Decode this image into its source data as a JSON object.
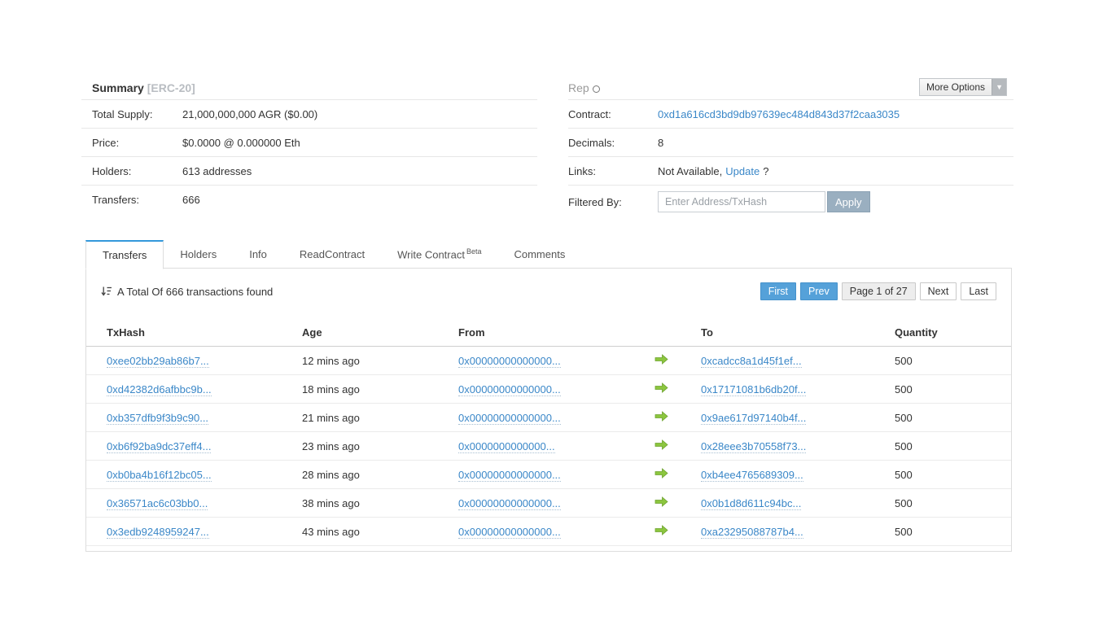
{
  "summary": {
    "title": "Summary",
    "title_tag": "[ERC-20]",
    "rows": [
      {
        "label": "Total Supply:",
        "value": "21,000,000,000 AGR ($0.00)"
      },
      {
        "label": "Price:",
        "value": "$0.0000 @ 0.000000 Eth"
      },
      {
        "label": "Holders:",
        "value": "613 addresses"
      },
      {
        "label": "Transfers:",
        "value": "666"
      }
    ]
  },
  "profile": {
    "title": "Rep",
    "more_options_label": "More Options",
    "rows": {
      "contract_label": "Contract:",
      "contract_value": "0xd1a616cd3bd9db97639ec484d843d37f2caa3035",
      "decimals_label": "Decimals:",
      "decimals_value": "8",
      "links_label": "Links:",
      "links_value": "Not Available,",
      "links_update": "Update",
      "links_question": "?",
      "filtered_label": "Filtered By:"
    },
    "filter": {
      "placeholder": "Enter Address/TxHash",
      "apply_label": "Apply"
    }
  },
  "tabs": [
    {
      "label": "Transfers"
    },
    {
      "label": "Holders"
    },
    {
      "label": "Info"
    },
    {
      "label": "ReadContract"
    },
    {
      "label": "Write Contract",
      "badge": "Beta"
    },
    {
      "label": "Comments"
    }
  ],
  "transfers": {
    "total_text": "A Total Of 666 transactions found",
    "pagination": {
      "first": "First",
      "prev": "Prev",
      "page": "Page 1 of 27",
      "next": "Next",
      "last": "Last"
    },
    "table": {
      "headers": [
        "TxHash",
        "Age",
        "From",
        "To",
        "Quantity"
      ],
      "rows": [
        {
          "txhash": "0xee02bb29ab86b7...",
          "age": "12 mins ago",
          "from": "0x00000000000000...",
          "to": "0xcadcc8a1d45f1ef...",
          "quantity": "500"
        },
        {
          "txhash": "0xd42382d6afbbc9b...",
          "age": "18 mins ago",
          "from": "0x00000000000000...",
          "to": "0x17171081b6db20f...",
          "quantity": "500"
        },
        {
          "txhash": "0xb357dfb9f3b9c90...",
          "age": "21 mins ago",
          "from": "0x00000000000000...",
          "to": "0x9ae617d97140b4f...",
          "quantity": "500"
        },
        {
          "txhash": "0xb6f92ba9dc37eff4...",
          "age": "23 mins ago",
          "from": "0x0000000000000...",
          "to": "0x28eee3b70558f73...",
          "quantity": "500"
        },
        {
          "txhash": "0xb0ba4b16f12bc05...",
          "age": "28 mins ago",
          "from": "0x00000000000000...",
          "to": "0xb4ee4765689309...",
          "quantity": "500"
        },
        {
          "txhash": "0x36571ac6c03bb0...",
          "age": "38 mins ago",
          "from": "0x00000000000000...",
          "to": "0x0b1d8d611c94bc...",
          "quantity": "500"
        },
        {
          "txhash": "0x3edb9248959247...",
          "age": "43 mins ago",
          "from": "0x00000000000000...",
          "to": "0xa23295088787b4...",
          "quantity": "500"
        }
      ]
    }
  },
  "colors": {
    "link": "#3a87c8",
    "tab_active_border": "#3498db",
    "pagination_active_bg": "#55a1d9",
    "apply_button_bg": "#9aafc0",
    "arrow_green": "#85c440",
    "row_divider": "#ebebeb"
  }
}
